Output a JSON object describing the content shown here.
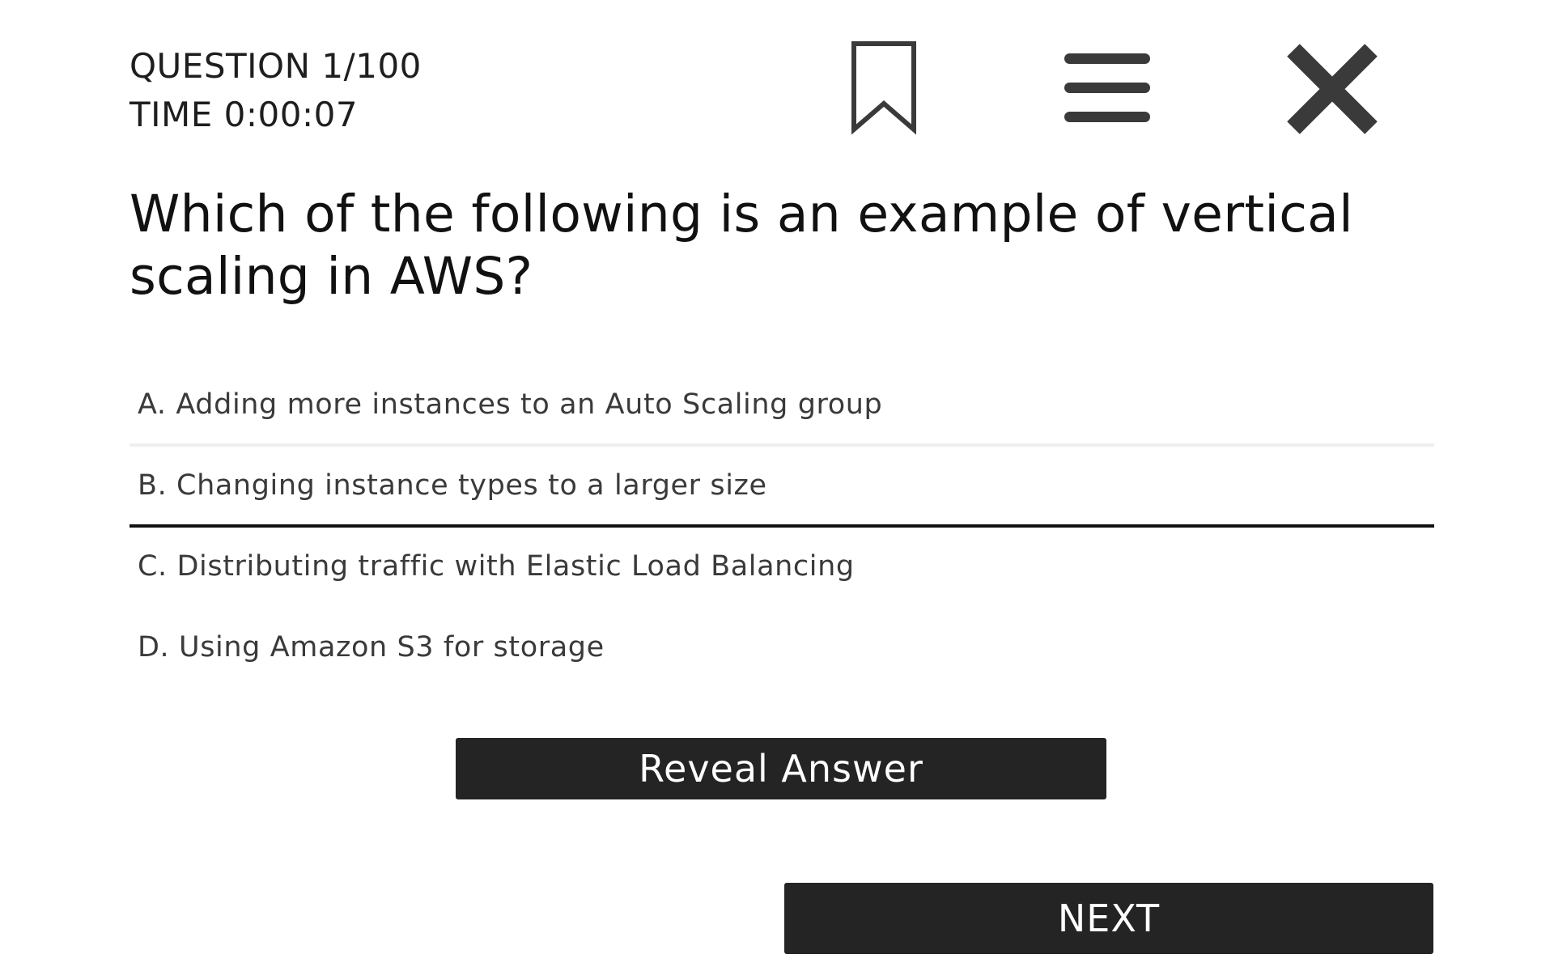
{
  "header": {
    "question_counter": "QUESTION 1/100",
    "timer": "TIME 0:00:07",
    "icons": {
      "bookmark": "bookmark-icon",
      "menu": "menu-icon",
      "close": "close-icon"
    },
    "icon_color": "#3a3a3a"
  },
  "question": {
    "text": "Which of the following is an example of vertical scaling in AWS?"
  },
  "options": [
    {
      "label": "A. Adding more instances to an Auto Scaling group",
      "state": "hovered"
    },
    {
      "label": "B. Changing instance types to a larger size",
      "state": "selected"
    },
    {
      "label": "C. Distributing traffic with Elastic Load Balancing",
      "state": "normal"
    },
    {
      "label": "D. Using Amazon S3 for storage",
      "state": "normal"
    }
  ],
  "buttons": {
    "reveal_label": "Reveal Answer",
    "next_label": "NEXT"
  },
  "colors": {
    "button_bg": "#242424",
    "selected_underline": "#111111",
    "hover_underline": "#efefef",
    "background": "#ffffff"
  }
}
